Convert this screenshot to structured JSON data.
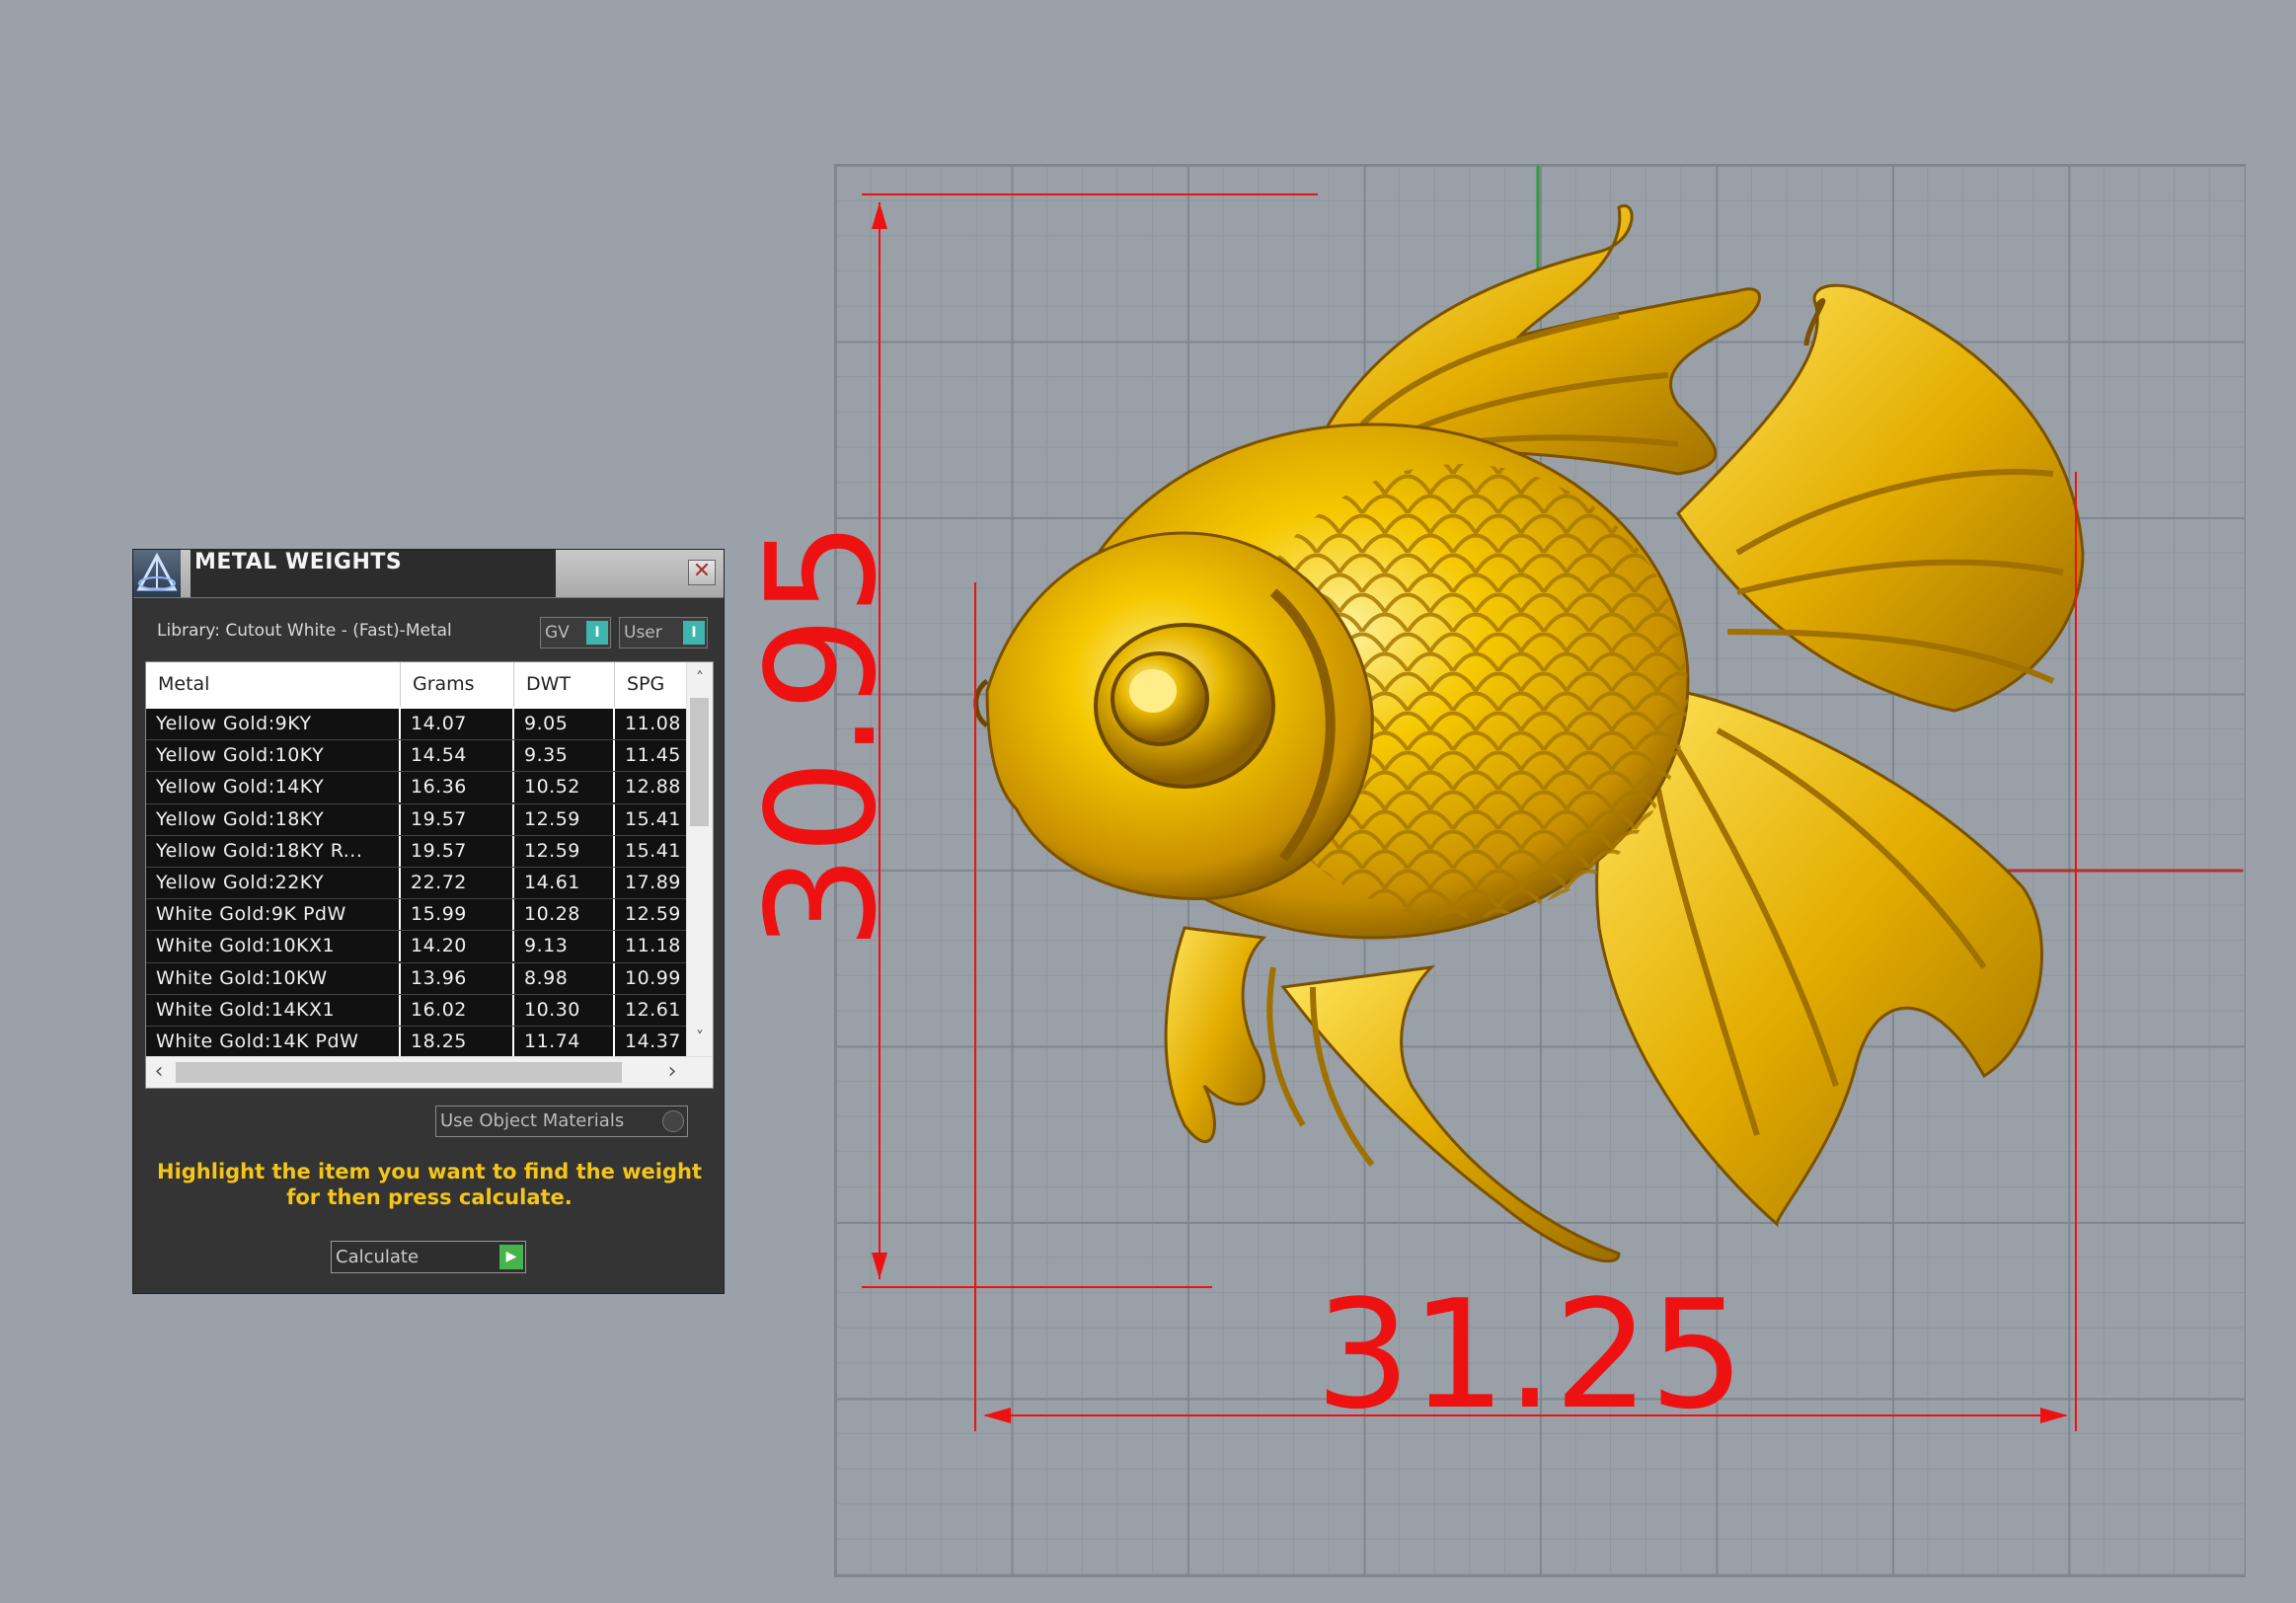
{
  "panel": {
    "title": "METAL WEIGHTS",
    "close_symbol": "✕",
    "library_label": "Library: Cutout White - (Fast)-Metal",
    "toggle_gv_label": "GV",
    "toggle_user_label": "User",
    "toggle_knob_symbol": "I",
    "use_object_materials_label": "Use Object Materials",
    "hint_line1": "Highlight the item you want to find the weight",
    "hint_line2": "for then press calculate.",
    "calculate_label": "Calculate",
    "calculate_arrow": "▶",
    "columns": [
      "Metal",
      "Grams",
      "DWT",
      "SPG"
    ],
    "rows": [
      {
        "metal": "Yellow Gold:9KY",
        "grams": "14.07",
        "dwt": "9.05",
        "spg": "11.08"
      },
      {
        "metal": "Yellow Gold:10KY",
        "grams": "14.54",
        "dwt": "9.35",
        "spg": "11.45"
      },
      {
        "metal": "Yellow Gold:14KY",
        "grams": "16.36",
        "dwt": "10.52",
        "spg": "12.88"
      },
      {
        "metal": "Yellow Gold:18KY",
        "grams": "19.57",
        "dwt": "12.59",
        "spg": "15.41"
      },
      {
        "metal": "Yellow Gold:18KY R...",
        "grams": "19.57",
        "dwt": "12.59",
        "spg": "15.41"
      },
      {
        "metal": "Yellow Gold:22KY",
        "grams": "22.72",
        "dwt": "14.61",
        "spg": "17.89"
      },
      {
        "metal": "White Gold:9K PdW",
        "grams": "15.99",
        "dwt": "10.28",
        "spg": "12.59"
      },
      {
        "metal": "White Gold:10KX1",
        "grams": "14.20",
        "dwt": "9.13",
        "spg": "11.18"
      },
      {
        "metal": "White Gold:10KW",
        "grams": "13.96",
        "dwt": "8.98",
        "spg": "10.99"
      },
      {
        "metal": "White Gold:14KX1",
        "grams": "16.02",
        "dwt": "10.30",
        "spg": "12.61"
      },
      {
        "metal": "White Gold:14K PdW",
        "grams": "18.25",
        "dwt": "11.74",
        "spg": "14.37"
      }
    ],
    "scroll_up": "˄",
    "scroll_down": "˅",
    "scroll_left": "‹",
    "scroll_right": "›"
  },
  "viewport": {
    "height_dimension": "30.95",
    "width_dimension": "31.25",
    "model_color": "#f2c200",
    "dimension_color": "#ee1111"
  }
}
